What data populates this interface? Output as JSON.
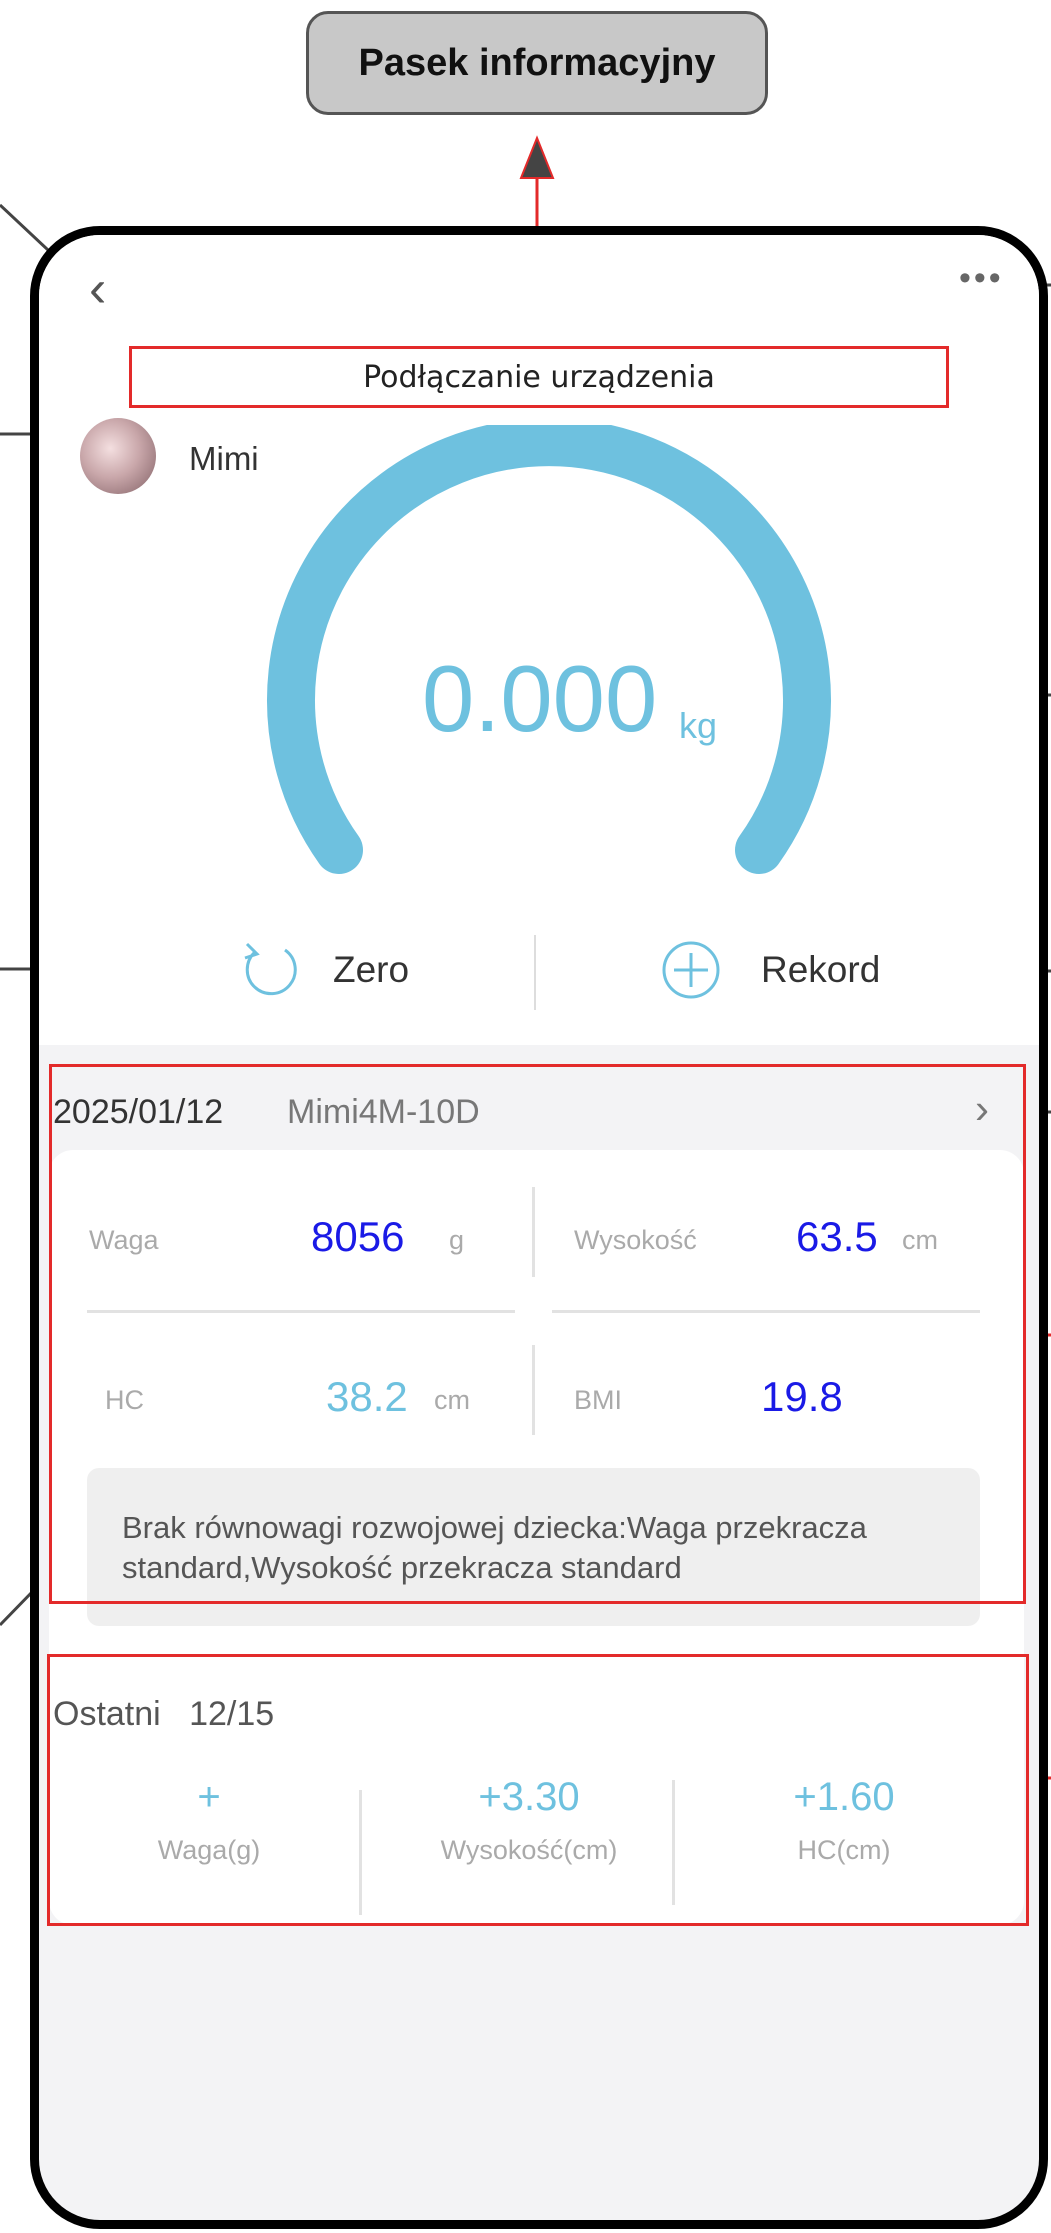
{
  "callout": {
    "label": "Pasek informacyjny"
  },
  "header": {
    "back_icon": "‹",
    "more_icon": "•••",
    "status": "Podłączanie urządzenia"
  },
  "user": {
    "name": "Mimi"
  },
  "scale": {
    "value": "0.000",
    "unit": "kg"
  },
  "actions": {
    "zero_label": "Zero",
    "record_label": "Rekord"
  },
  "record": {
    "date": "2025/01/12",
    "device": "Mimi4M-10D",
    "metrics": [
      {
        "label": "Waga",
        "value": "8056",
        "unit": "g",
        "color": "#1a1ae6"
      },
      {
        "label": "Wysokość",
        "value": "63.5",
        "unit": "cm",
        "color": "#1a1ae6"
      },
      {
        "label": "HC",
        "value": "38.2",
        "unit": "cm",
        "color": "#6ec1df"
      },
      {
        "label": "BMI",
        "value": "19.8",
        "unit": "",
        "color": "#1a1ae6"
      }
    ],
    "advice": "Brak równowagi rozwojowej dziecka:Waga przekracza standard,Wysokość przekracza standard"
  },
  "recent": {
    "label": "Ostatni",
    "date": "12/15",
    "changes": [
      {
        "value": "+",
        "label": "Waga(g)"
      },
      {
        "value": "+3.30",
        "label": "Wysokość(cm)"
      },
      {
        "value": "+1.60",
        "label": "HC(cm)"
      }
    ]
  },
  "colors": {
    "accent": "#6ec1df",
    "metric_blue": "#1a1ae6",
    "highlight": "#e32a2a"
  }
}
